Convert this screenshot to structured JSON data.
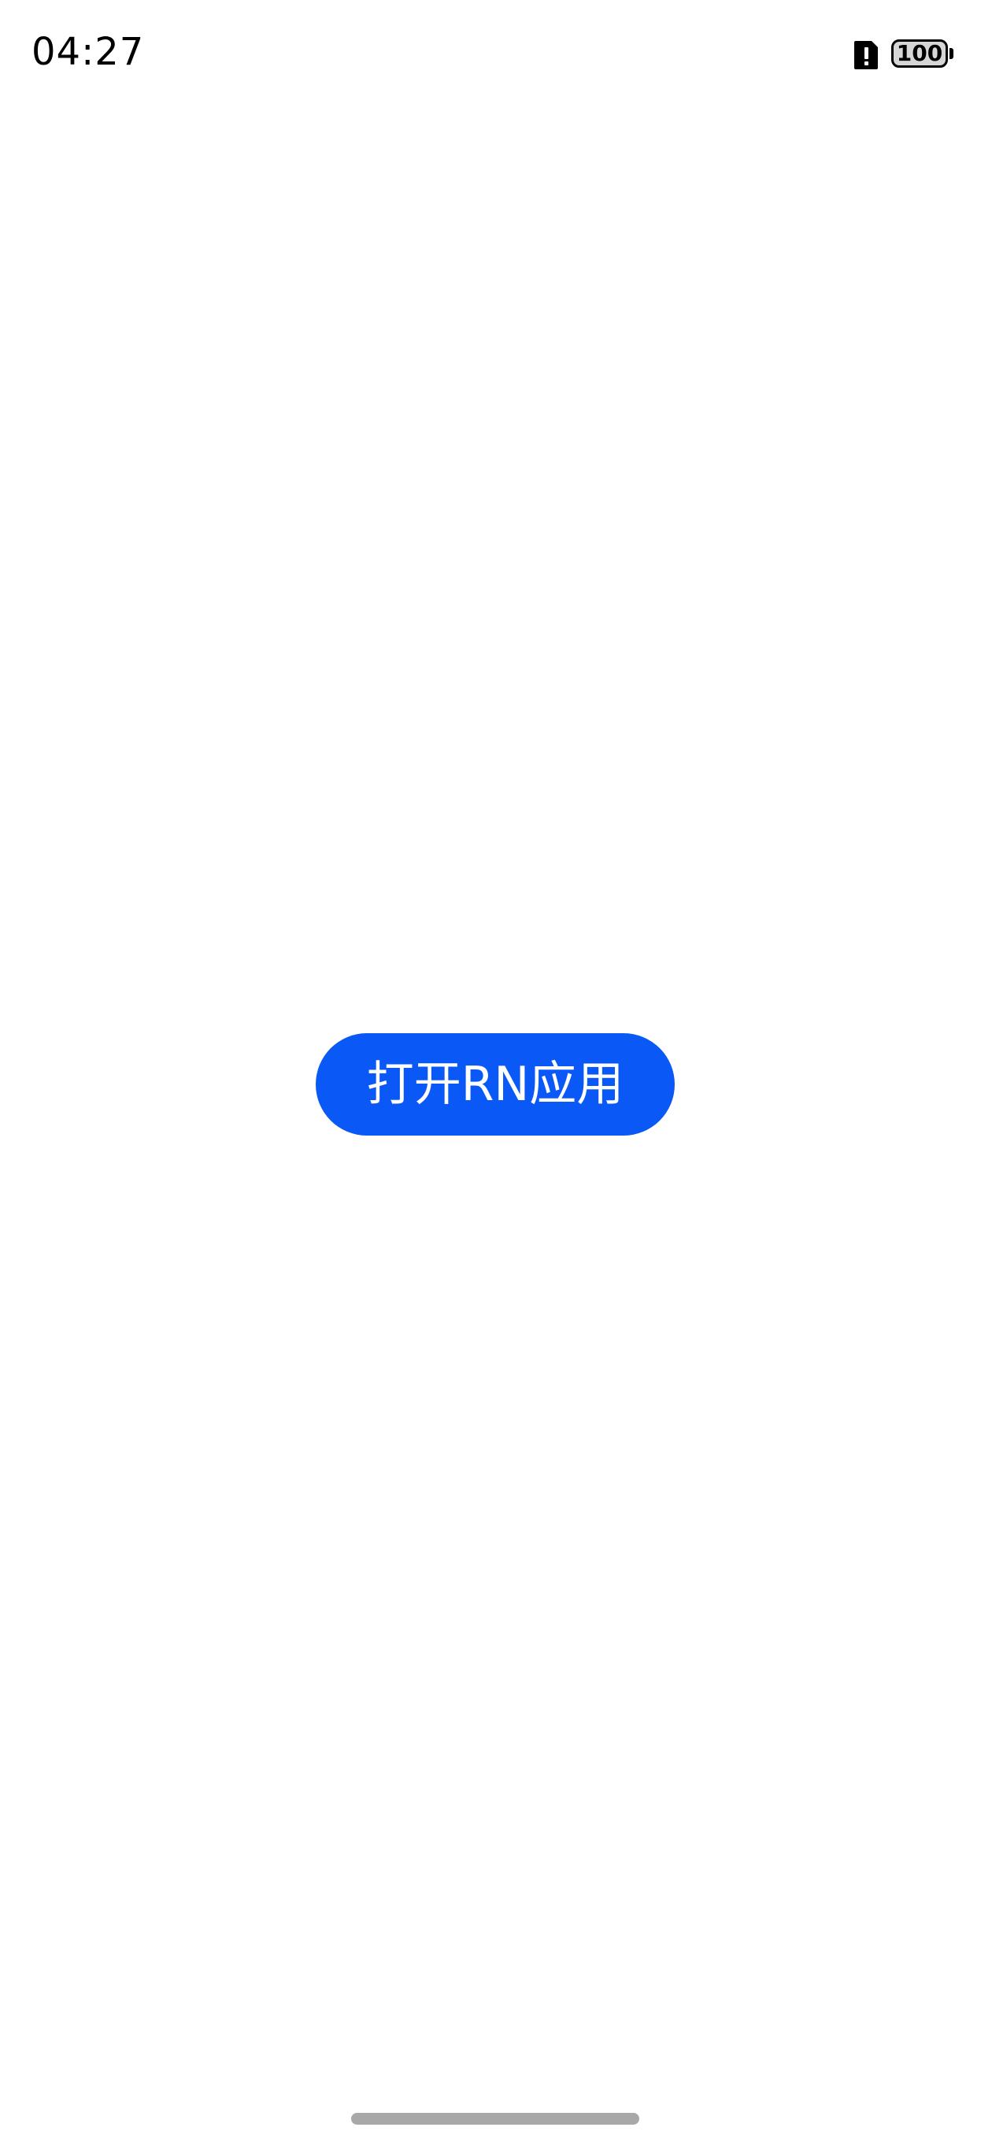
{
  "status_bar": {
    "time": "04:27",
    "battery_level": "100",
    "icons": [
      "sim-alert-icon",
      "battery-icon"
    ]
  },
  "main": {
    "open_button_label": "打开RN应用"
  },
  "colors": {
    "button_background": "#0a59f7",
    "button_text": "#ffffff",
    "background": "#ffffff",
    "home_indicator": "#a8a8a8"
  }
}
